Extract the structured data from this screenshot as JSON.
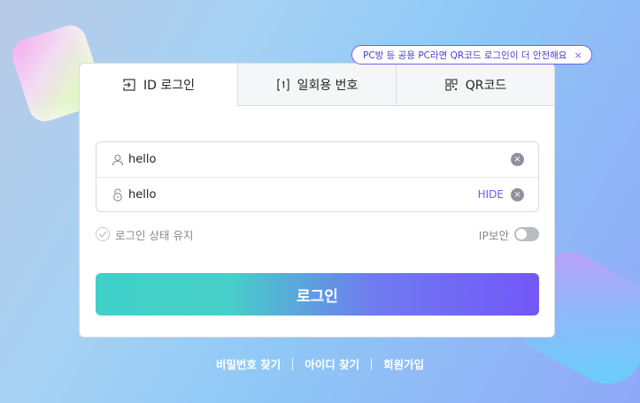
{
  "tooltip": {
    "text": "PC방 등 공용 PC라면 QR코드 로그인이 더 안전해요",
    "close_label": "×"
  },
  "tabs": [
    {
      "label": "ID 로그인",
      "icon": "login-arrow-icon",
      "active": true
    },
    {
      "label": "일회용 번호",
      "icon": "one-time-number-icon",
      "active": false
    },
    {
      "label": "QR코드",
      "icon": "qr-code-icon",
      "active": false
    }
  ],
  "form": {
    "id_value": "hello",
    "password_value": "hello",
    "hide_label": "HIDE",
    "clear_label": "×"
  },
  "options": {
    "keep_login_label": "로그인 상태 유지",
    "ip_security_label": "IP보안",
    "ip_security_on": false
  },
  "login_button": "로그인",
  "footer": {
    "find_password": "비밀번호 찾기",
    "find_id": "아이디 찾기",
    "signup": "회원가입"
  },
  "colors": {
    "accent_purple": "#7357f7",
    "accent_teal": "#3fd0c9"
  }
}
